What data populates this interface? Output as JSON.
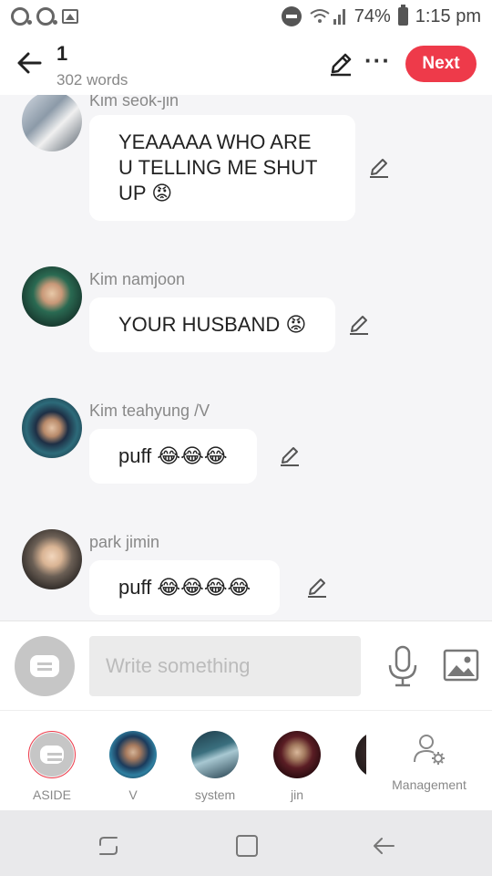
{
  "status": {
    "battery": "74%",
    "time": "1:15 pm"
  },
  "header": {
    "title": "1",
    "word_count": "302 words",
    "next_label": "Next"
  },
  "messages": [
    {
      "name": "Kim seok-jin",
      "text": "YEAAAAA WHO ARE U TELLING ME SHUT UP 😡"
    },
    {
      "name": "Kim namjoon",
      "text": "YOUR HUSBAND 😡"
    },
    {
      "name": "Kim teahyung /V",
      "text": "puff 😂😂😂"
    },
    {
      "name": "park jimin",
      "text": "puff 😂😂😂😂"
    }
  ],
  "composer": {
    "placeholder": "Write something"
  },
  "characters": [
    {
      "label": "ASIDE"
    },
    {
      "label": "V"
    },
    {
      "label": "system"
    },
    {
      "label": "jin"
    }
  ],
  "management": {
    "label": "Management"
  },
  "colors": {
    "accent": "#ee3a4a",
    "name_gray": "#888888",
    "background": "#f5f5f7"
  },
  "icons": [
    "back-arrow-icon",
    "pencil-icon",
    "more-icon",
    "microphone-icon",
    "image-icon",
    "chat-bubble-icon",
    "person-gear-icon",
    "recent-apps-icon",
    "home-icon",
    "back-icon"
  ]
}
